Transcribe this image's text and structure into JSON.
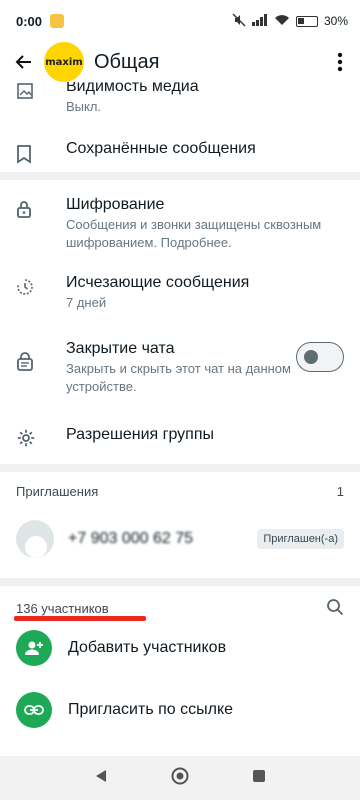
{
  "status": {
    "time": "0:00",
    "battery": "30%"
  },
  "header": {
    "title": "Общая",
    "avatar_logo": "maxim"
  },
  "settings": {
    "media": {
      "label": "Видимость медиа",
      "value": "Выкл."
    },
    "saved": {
      "label": "Сохранённые сообщения"
    },
    "encryption": {
      "label": "Шифрование",
      "desc": "Сообщения и звонки защищены сквозным шифрованием. Подробнее."
    },
    "disappearing": {
      "label": "Исчезающие сообщения",
      "value": "7 дней"
    },
    "chat_lock": {
      "label": "Закрытие чата",
      "desc": "Закрыть и скрыть этот чат на данном устройстве.",
      "enabled": false
    },
    "group_perms": {
      "label": "Разрешения группы"
    }
  },
  "invitations": {
    "header": "Приглашения",
    "count": "1",
    "items": [
      {
        "name": "+7 903 000 62 75",
        "status": "Приглашен(-а)"
      }
    ]
  },
  "members": {
    "header": "136 участников",
    "actions": [
      {
        "label": "Добавить участников"
      },
      {
        "label": "Пригласить по ссылке"
      }
    ]
  },
  "colors": {
    "accent_green": "#1da956",
    "highlight_red": "#e8291c",
    "logo_yellow": "#ffd500"
  }
}
